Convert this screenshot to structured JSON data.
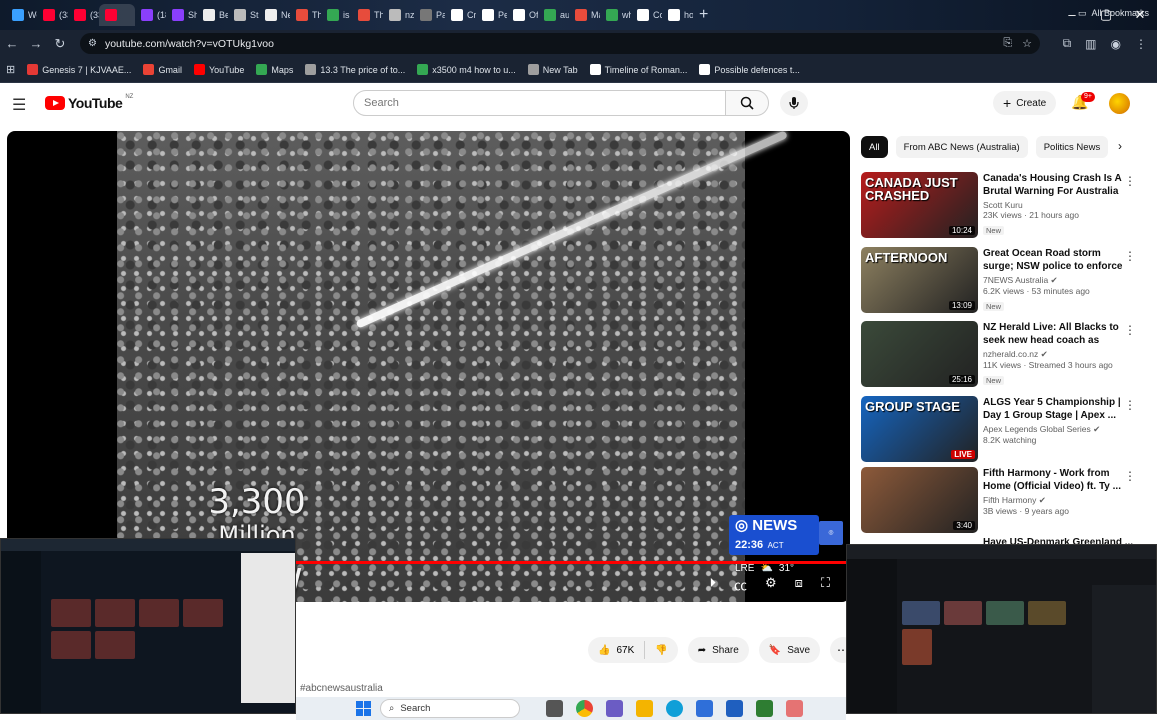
{
  "browser": {
    "tabs": [
      {
        "label": "We",
        "color": "#3aa0ff"
      },
      {
        "label": "(33",
        "color": "#ff0033"
      },
      {
        "label": "(33",
        "color": "#ff0033"
      },
      {
        "label": "",
        "color": "#ff0033"
      },
      {
        "label": "(18",
        "color": "#8a3ffc"
      },
      {
        "label": "Sh",
        "color": "#8a3ffc"
      },
      {
        "label": "Be",
        "color": "#eeeeee"
      },
      {
        "label": "Str",
        "color": "#bbbbbb"
      },
      {
        "label": "Ne",
        "color": "#eeeeee"
      },
      {
        "label": "Th",
        "color": "#e74c3c"
      },
      {
        "label": "is a",
        "color": "#34a853"
      },
      {
        "label": "Th",
        "color": "#e74c3c"
      },
      {
        "label": "nz",
        "color": "#bbbbbb"
      },
      {
        "label": "Pa",
        "color": "#777777"
      },
      {
        "label": "Cr",
        "color": "#ffffff"
      },
      {
        "label": "Pe",
        "color": "#ffffff"
      },
      {
        "label": "Of",
        "color": "#ffffff"
      },
      {
        "label": "au",
        "color": "#34a853"
      },
      {
        "label": "Ma",
        "color": "#e74c3c"
      },
      {
        "label": "wh",
        "color": "#34a853"
      },
      {
        "label": "Co",
        "color": "#ffffff"
      },
      {
        "label": "ho",
        "color": "#ffffff"
      }
    ],
    "url": "youtube.com/watch?v=vOTUkg1voo",
    "bookmarks": [
      {
        "label": "Genesis 7 | KJVAAE...",
        "color": "#e53935"
      },
      {
        "label": "Gmail",
        "color": "#ea4335"
      },
      {
        "label": "YouTube",
        "color": "#ff0000"
      },
      {
        "label": "Maps",
        "color": "#34a853"
      },
      {
        "label": "13.3 The price of to...",
        "color": "#9e9e9e"
      },
      {
        "label": "x3500 m4 how to u...",
        "color": "#34a853"
      },
      {
        "label": "New Tab",
        "color": "#9e9e9e"
      },
      {
        "label": "Timeline of Roman...",
        "color": "#ffffff"
      },
      {
        "label": "Possible defences t...",
        "color": "#ffffff"
      }
    ],
    "all_bookmarks": "All Bookmarks"
  },
  "youtube": {
    "wordmark": "YouTube",
    "country": "NZ",
    "search_placeholder": "Search",
    "create_label": "Create",
    "notification_count": "9+"
  },
  "video": {
    "overlay_number": "3,300",
    "overlay_unit": "Million",
    "overlay_now": "NOW",
    "news_brand": "NEWS",
    "news_time": "22:36",
    "news_tz": "ACT",
    "weather_code": "LRE",
    "weather_temp": "31°",
    "progress_fraction": 1.0
  },
  "actions": {
    "likes": "67K",
    "share": "Share",
    "save": "Save",
    "hashtag": "#abcnewsaustralia"
  },
  "sidebar": {
    "chips": [
      "All",
      "From ABC News (Australia)",
      "Politics News"
    ],
    "recommendations": [
      {
        "title": "Canada's Housing Crash Is A Brutal Warning For Australia ...",
        "channel": "Scott Kuru",
        "stats": "23K views · 21 hours ago",
        "badge": "New",
        "duration": "10:24",
        "thumb_text": "CANADA JUST CRASHED",
        "thumb_color": "#b71c1c"
      },
      {
        "title": "Great Ocean Road storm surge; NSW police to enforce protest ...",
        "channel": "7NEWS Australia ✔",
        "stats": "6.2K views · 53 minutes ago",
        "badge": "New",
        "duration": "13:09",
        "thumb_text": "AFTERNOON",
        "thumb_color": "#8d8060"
      },
      {
        "title": "NZ Herald Live: All Blacks to seek new head coach as Scott...",
        "channel": "nzherald.co.nz ✔",
        "stats": "11K views · Streamed 3 hours ago",
        "badge": "New",
        "duration": "25:16",
        "thumb_text": "",
        "thumb_color": "#3b4a3a"
      },
      {
        "title": "ALGS Year 5 Championship | Day 1 Group Stage | Apex ...",
        "channel": "Apex Legends Global Series ✔",
        "stats": "8.2K watching",
        "badge": "",
        "duration": "LIVE",
        "thumb_text": "GROUP STAGE",
        "thumb_color": "#1565c0"
      },
      {
        "title": "Fifth Harmony - Work from Home (Official Video) ft. Ty ...",
        "channel": "Fifth Harmony ✔",
        "stats": "3B views · 9 years ago",
        "badge": "",
        "duration": "3:40",
        "thumb_text": "",
        "thumb_color": "#8d5a3a"
      }
    ],
    "partial_title": "Have US-Denmark Greenland ..."
  },
  "taskbar": {
    "search_label": "Search"
  }
}
